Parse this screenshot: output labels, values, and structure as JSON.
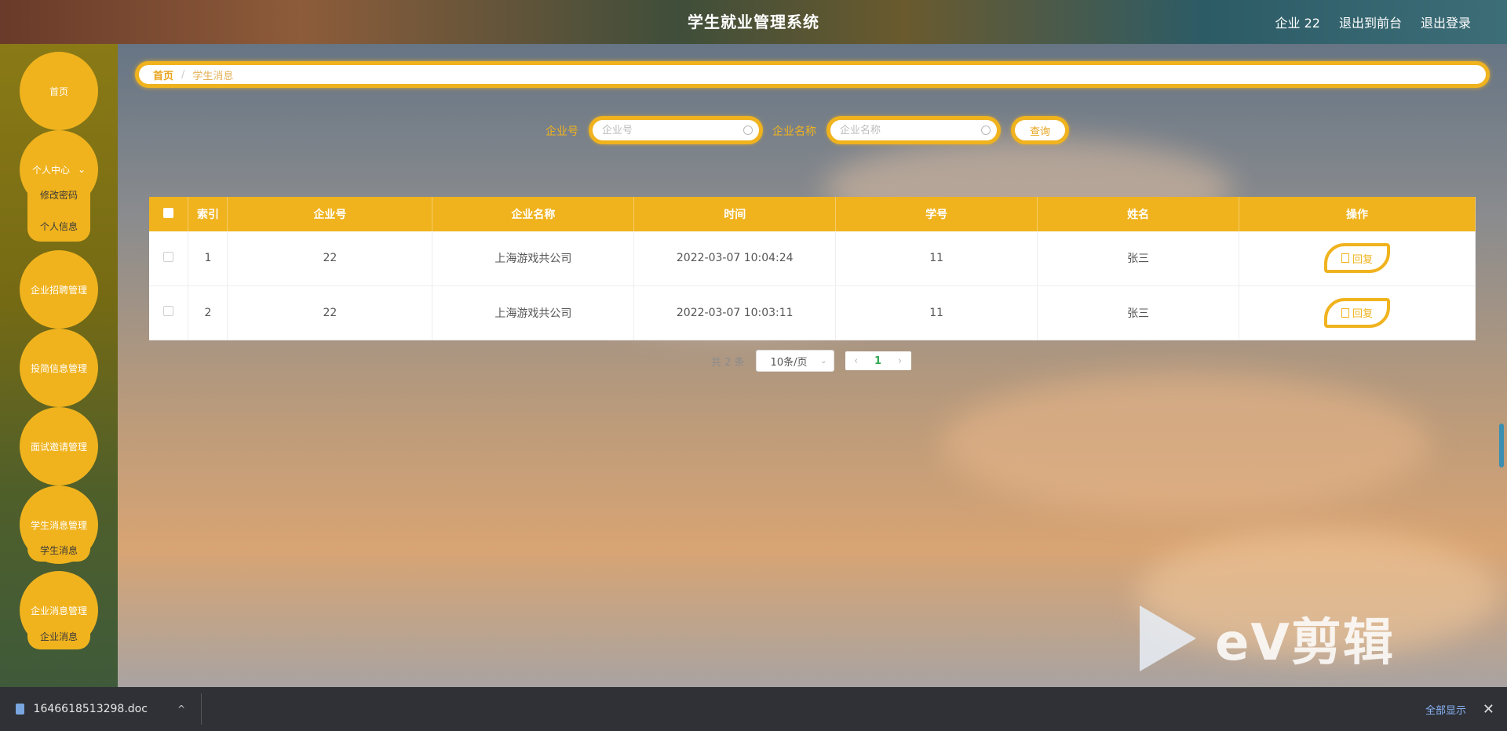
{
  "header": {
    "title": "学生就业管理系统",
    "user": "企业 22",
    "exit_front": "退出到前台",
    "logout": "退出登录"
  },
  "sidebar": {
    "items": [
      {
        "label": "首页",
        "chevron": false
      },
      {
        "label": "个人中心",
        "chevron": true,
        "sub": [
          "修改密码",
          "个人信息"
        ]
      },
      {
        "label": "企业招聘管理",
        "chevron": false
      },
      {
        "label": "投简信息管理",
        "chevron": false
      },
      {
        "label": "面试邀请管理",
        "chevron": false
      },
      {
        "label": "学生消息管理",
        "chevron": false,
        "sub": [
          "学生消息"
        ]
      },
      {
        "label": "企业消息管理",
        "chevron": false,
        "sub": [
          "企业消息"
        ]
      }
    ]
  },
  "breadcrumb": {
    "home": "首页",
    "separator": "/",
    "current": "学生消息"
  },
  "search": {
    "company_id_label": "企业号",
    "company_id_placeholder": "企业号",
    "company_name_label": "企业名称",
    "company_name_placeholder": "企业名称",
    "query_label": "查询"
  },
  "table": {
    "columns": [
      "索引",
      "企业号",
      "企业名称",
      "时间",
      "学号",
      "姓名",
      "操作"
    ],
    "rows": [
      {
        "index": "1",
        "company_id": "22",
        "company_name": "上海游戏共公司",
        "time": "2022-03-07 10:04:24",
        "student_id": "11",
        "name": "张三",
        "action": "回复"
      },
      {
        "index": "2",
        "company_id": "22",
        "company_name": "上海游戏共公司",
        "time": "2022-03-07 10:03:11",
        "student_id": "11",
        "name": "张三",
        "action": "回复"
      }
    ]
  },
  "pagination": {
    "total": "共 2 条",
    "page_size": "10条/页",
    "current_page": "1",
    "prev": "‹",
    "next": "›"
  },
  "watermark": "eV剪辑",
  "download_bar": {
    "file_name": "1646618513298.doc",
    "show_all": "全部显示",
    "close": "✕",
    "caret": "^"
  },
  "colors": {
    "accent": "#f0b31e",
    "sidebar": "#756a14",
    "download_bar": "#2f3136"
  }
}
